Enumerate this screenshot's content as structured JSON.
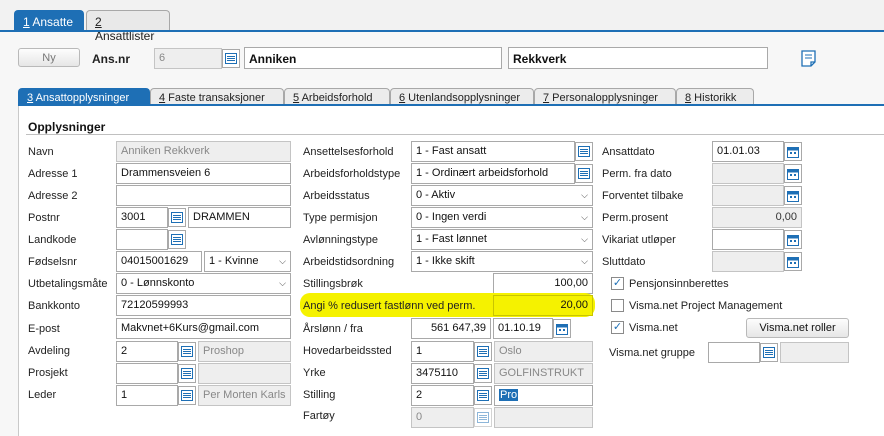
{
  "top_tabs": [
    {
      "num": "1",
      "label": " Ansatte"
    },
    {
      "num": "2",
      "label": " Ansattlister"
    }
  ],
  "header": {
    "new_button": "Ny",
    "ans_nr_label": "Ans.nr",
    "ans_nr_value": "6",
    "first_name": "Anniken",
    "last_name": "Rekkverk"
  },
  "sub_tabs": [
    {
      "num": "3",
      "label": " Ansattopplysninger"
    },
    {
      "num": "4",
      "label": " Faste transaksjoner"
    },
    {
      "num": "5",
      "label": " Arbeidsforhold"
    },
    {
      "num": "6",
      "label": " Utenlandsopplysninger"
    },
    {
      "num": "7",
      "label": " Personalopplysninger"
    },
    {
      "num": "8",
      "label": " Historikk"
    }
  ],
  "section_title": "Opplysninger",
  "col1": {
    "navn_label": "Navn",
    "navn_value": "Anniken Rekkverk",
    "adresse1_label": "Adresse 1",
    "adresse1_value": "Drammensveien 6",
    "adresse2_label": "Adresse 2",
    "adresse2_value": "",
    "postnr_label": "Postnr",
    "postnr_value": "3001",
    "poststed_value": "DRAMMEN",
    "landkode_label": "Landkode",
    "landkode_value": "",
    "fodselsnr_label": "Fødselsnr",
    "fodselsnr_value": "04015001629",
    "kjonn_value": "1 - Kvinne",
    "utbetaling_label": "Utbetalingsmåte",
    "utbetaling_value": "0 - Lønnskonto",
    "bankkonto_label": "Bankkonto",
    "bankkonto_value": "72120599993",
    "epost_label": "E-post",
    "epost_value": "Makvnet+6Kurs@gmail.com",
    "avdeling_label": "Avdeling",
    "avdeling_value": "2",
    "avdeling_name": "Proshop",
    "prosjekt_label": "Prosjekt",
    "prosjekt_value": "",
    "prosjekt_name": "",
    "leder_label": "Leder",
    "leder_value": "1",
    "leder_name": "Per Morten Karls"
  },
  "col2": {
    "ansettelsesforhold_label": "Ansettelsesforhold",
    "ansettelsesforhold_value": "1 - Fast ansatt",
    "arbeidsforholdstype_label": "Arbeidsforholdstype",
    "arbeidsforholdstype_value": "1 - Ordinært arbeidsforhold",
    "arbeidsstatus_label": "Arbeidsstatus",
    "arbeidsstatus_value": "0 - Aktiv",
    "typepermisjon_label": "Type permisjon",
    "typepermisjon_value": "0 - Ingen verdi",
    "avlonningstype_label": "Avlønningstype",
    "avlonningstype_value": "1 - Fast lønnet",
    "arbeidstidsordning_label": "Arbeidstidsordning",
    "arbeidstidsordning_value": "1 - Ikke skift",
    "stillingsbrok_label": "Stillingsbrøk",
    "stillingsbrok_value": "100,00",
    "redusert_label": "Angi % redusert fastlønn ved perm.",
    "redusert_value": "20,00",
    "arslonn_label": "Årslønn / fra",
    "arslonn_value": "561 647,39",
    "arslonn_fra": "01.10.19",
    "hovedarbeidssted_label": "Hovedarbeidssted",
    "hovedarbeidssted_value": "1",
    "hovedarbeidssted_name": "Oslo",
    "yrke_label": "Yrke",
    "yrke_value": "3475110",
    "yrke_name": "GOLFINSTRUKT",
    "stilling_label": "Stilling",
    "stilling_value": "2",
    "stilling_name": "Pro",
    "fartoy_label": "Fartøy",
    "fartoy_value": "0",
    "fartoy_name": ""
  },
  "col3": {
    "ansattdato_label": "Ansattdato",
    "ansattdato_value": "01.01.03",
    "permfradato_label": "Perm. fra dato",
    "permfradato_value": "",
    "forventet_label": "Forventet tilbake",
    "forventet_value": "",
    "permprosent_label": "Perm.prosent",
    "permprosent_value": "0,00",
    "vikariat_label": "Vikariat utløper",
    "vikariat_value": "",
    "sluttdato_label": "Sluttdato",
    "sluttdato_value": "",
    "pensjon_label": "Pensjonsinnberettes",
    "pensjon_checked": true,
    "vismapm_label": "Visma.net Project Management",
    "vismapm_checked": false,
    "vismanet_label": "Visma.net",
    "vismanet_checked": true,
    "roller_button": "Visma.net roller",
    "gruppe_label": "Visma.net gruppe",
    "gruppe_value": "",
    "gruppe_name": ""
  },
  "colors": {
    "accent": "#1e6fb5",
    "highlight": "#f5f200"
  }
}
